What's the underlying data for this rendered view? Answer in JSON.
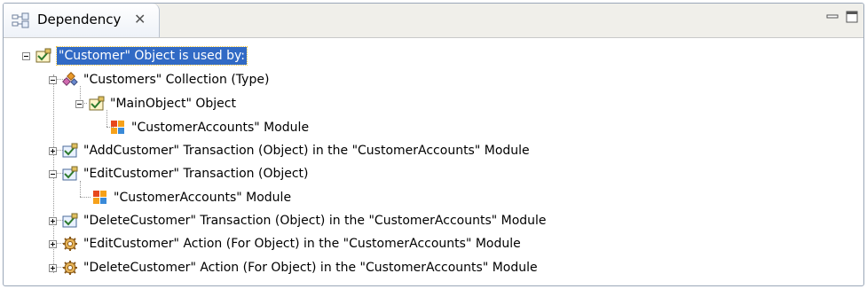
{
  "view": {
    "tab_title": "Dependency",
    "tab_close_glyph": "✕",
    "tab_icon": "dependency-view-icon",
    "controls": {
      "minimize_icon": "minimize-icon",
      "maximize_icon": "maximize-icon"
    }
  },
  "tree": {
    "items": [
      {
        "label": "\"Customer\" Object is used by:",
        "icon": "object-icon",
        "expander": "collapse",
        "selected": true
      },
      {
        "label": "\"Customers\" Collection (Type)",
        "icon": "collection-icon",
        "expander": "collapse"
      },
      {
        "label": "\"MainObject\" Object",
        "icon": "object-icon",
        "expander": "collapse"
      },
      {
        "label": "\"CustomerAccounts\" Module",
        "icon": "module-icon"
      },
      {
        "label": "\"AddCustomer\" Transaction (Object) in the \"CustomerAccounts\" Module",
        "icon": "transaction-icon",
        "expander": "expand"
      },
      {
        "label": "\"EditCustomer\" Transaction (Object)",
        "icon": "transaction-icon",
        "expander": "collapse"
      },
      {
        "label": "\"CustomerAccounts\" Module",
        "icon": "module-icon"
      },
      {
        "label": "\"DeleteCustomer\" Transaction (Object) in the \"CustomerAccounts\" Module",
        "icon": "transaction-icon",
        "expander": "expand"
      },
      {
        "label": "\"EditCustomer\" Action (For Object) in the \"CustomerAccounts\" Module",
        "icon": "action-gear-icon",
        "expander": "expand"
      },
      {
        "label": "\"DeleteCustomer\" Action (For Object) in the \"CustomerAccounts\" Module",
        "icon": "action-gear-icon",
        "expander": "expand"
      }
    ]
  },
  "colors": {
    "selection": "#316ac5",
    "border": "#9aa7b8",
    "title_bar": "#f0efea"
  }
}
